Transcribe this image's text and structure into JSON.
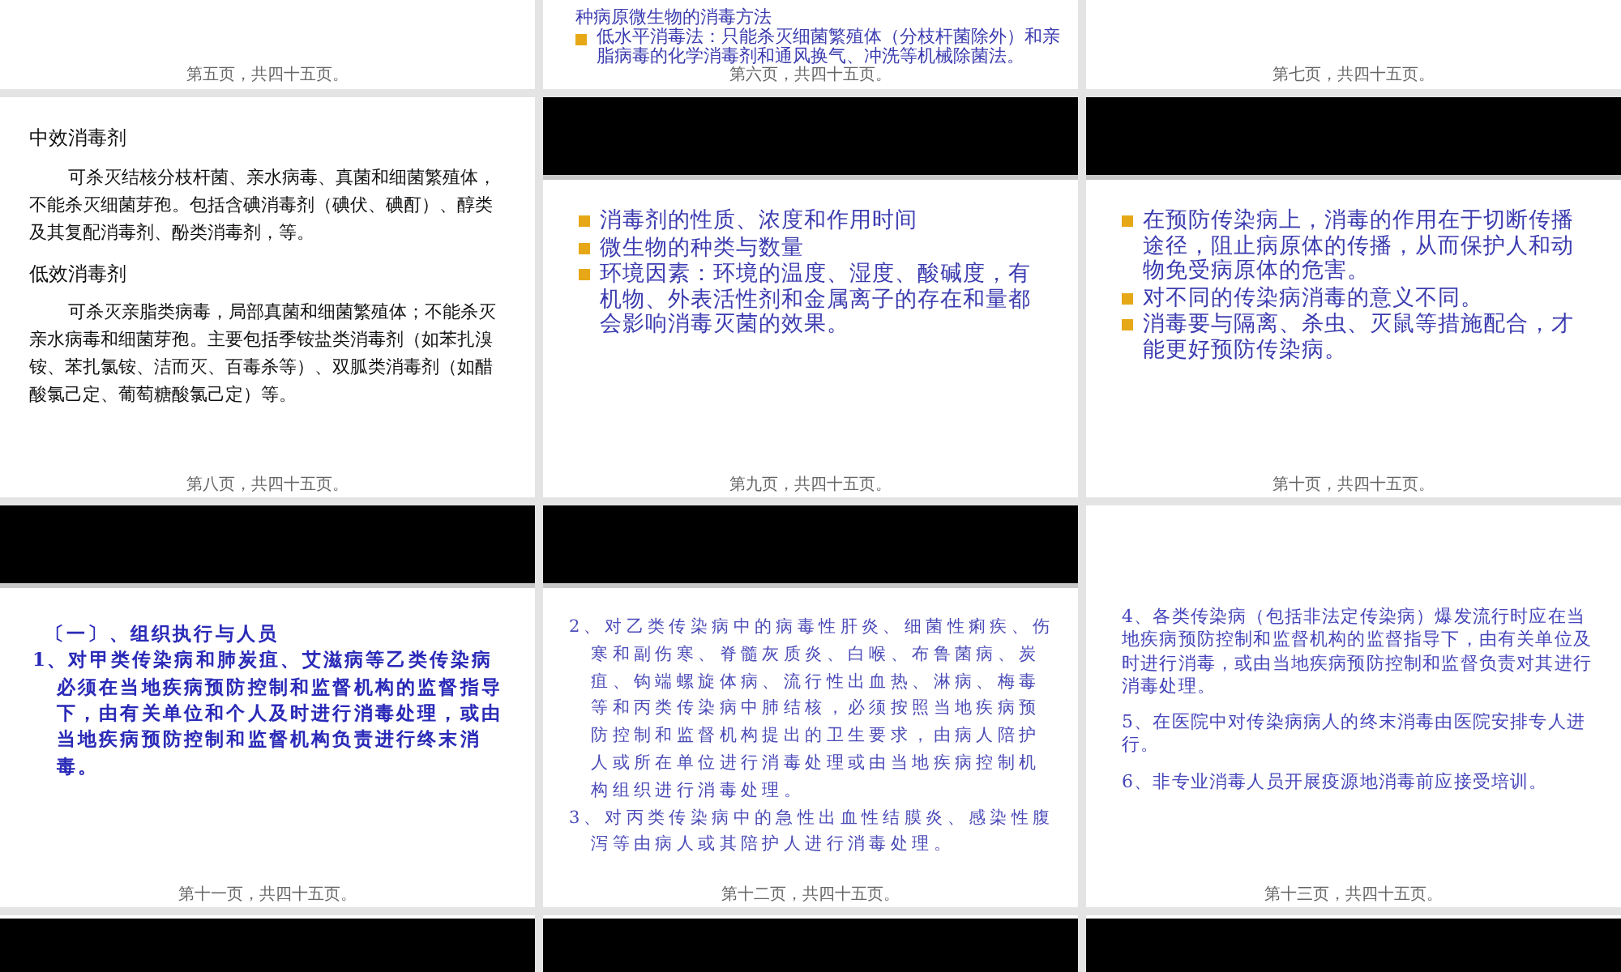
{
  "slides": [
    {
      "header": false,
      "kind": "plain",
      "footer": "第五页，共四十五页。"
    },
    {
      "header": false,
      "kind": "plain",
      "blocks": [
        {
          "kind": "plain",
          "text": "种病原微生物的消毒方法"
        },
        {
          "kind": "bullet",
          "text": "低水平消毒法：只能杀灭细菌繁殖体（分枝杆菌除外）和亲脂病毒的化学消毒剂和通风换气、冲洗等机械除菌法。"
        }
      ],
      "footer": "第六页，共四十五页。"
    },
    {
      "header": false,
      "kind": "plain",
      "footer": "第七页，共四十五页。"
    },
    {
      "header": false,
      "kind": "black",
      "blocks": [
        {
          "kind": "heading",
          "text": "中效消毒剂"
        },
        {
          "kind": "indent",
          "text": "可杀灭结核分枝杆菌、亲水病毒、真菌和细菌繁殖体，不能杀灭细菌芽孢。包括含碘消毒剂（碘伏、碘酊）、醇类及其复配消毒剂、酚类消毒剂，等。"
        },
        {
          "kind": "heading",
          "text": "低效消毒剂"
        },
        {
          "kind": "indent",
          "text": "可杀灭亲脂类病毒，局部真菌和细菌繁殖体；不能杀灭亲水病毒和细菌芽孢。主要包括季铵盐类消毒剂（如苯扎溴铵、苯扎氯铵、洁而灭、百毒杀等）、双胍类消毒剂（如醋酸氯己定、葡萄糖酸氯己定）等。"
        }
      ],
      "footer": "第八页，共四十五页。"
    },
    {
      "header": true,
      "kind": "plain",
      "blocks": [
        {
          "kind": "bullet",
          "text": "消毒剂的性质、浓度和作用时间"
        },
        {
          "kind": "bullet",
          "text": "微生物的种类与数量"
        },
        {
          "kind": "bullet",
          "text": "环境因素：环境的温度、湿度、酸碱度，有机物、外表活性剂和金属离子的存在和量都会影响消毒灭菌的效果。"
        }
      ],
      "footer": "第九页，共四十五页。"
    },
    {
      "header": true,
      "kind": "plain",
      "blocks": [
        {
          "kind": "bullet",
          "text": "在预防传染病上，消毒的作用在于切断传播途径，阻止病原体的传播，从而保护人和动物免受病原体的危害。"
        },
        {
          "kind": "bullet",
          "text": "对不同的传染病消毒的意义不同。"
        },
        {
          "kind": "bullet",
          "text": "消毒要与隔离、杀虫、灭鼠等措施配合，才能更好预防传染病。"
        }
      ],
      "footer": "第十页，共四十五页。"
    },
    {
      "header": true,
      "kind": "bold",
      "blocks": [
        {
          "kind": "plain",
          "text": "〔一〕、组织执行与人员"
        },
        {
          "kind": "hanging",
          "text": "1、对甲类传染病和肺炭疽、艾滋病等乙类传染病必须在当地疾病预防控制和监督机构的监督指导下，由有关单位和个人及时进行消毒处理，或由当地疾病预防控制和监督机构负责进行终末消毒。"
        }
      ],
      "footer": "第十一页，共四十五页。"
    },
    {
      "header": true,
      "kind": "spaced",
      "blocks": [
        {
          "kind": "hanging",
          "text": "2、对乙类传染病中的病毒性肝炎、细菌性痢疾、伤寒和副伤寒、脊髓灰质炎、白喉、布鲁菌病、炭疽、钩端螺旋体病、流行性出血热、淋病、梅毒等和丙类传染病中肺结核，必须按照当地疾病预防控制和监督机构提出的卫生要求，由病人陪护人或所在单位进行消毒处理或由当地疾病控制机构组织进行消毒处理。"
        },
        {
          "kind": "hanging",
          "text": "3、对丙类传染病中的急性出血性结膜炎、感染性腹泻等由病人或其陪护人进行消毒处理。"
        }
      ],
      "footer": "第十二页，共四十五页。"
    },
    {
      "header": false,
      "kind": "light",
      "blocks": [
        {
          "kind": "para",
          "text": "4、各类传染病（包括非法定传染病）爆发流行时应在当地疾病预防控制和监督机构的监督指导下，由有关单位及时进行消毒，或由当地疾病预防控制和监督负责对其进行消毒处理。"
        },
        {
          "kind": "para",
          "text": "5、在医院中对传染病病人的终末消毒由医院安排专人进行。"
        },
        {
          "kind": "para",
          "text": "6、非专业消毒人员开展疫源地消毒前应接受培训。"
        }
      ],
      "footer": "第十三页，共四十五页。"
    },
    {
      "header": true,
      "kind": "plain"
    },
    {
      "header": true,
      "kind": "plain"
    },
    {
      "header": true,
      "kind": "plain"
    }
  ]
}
